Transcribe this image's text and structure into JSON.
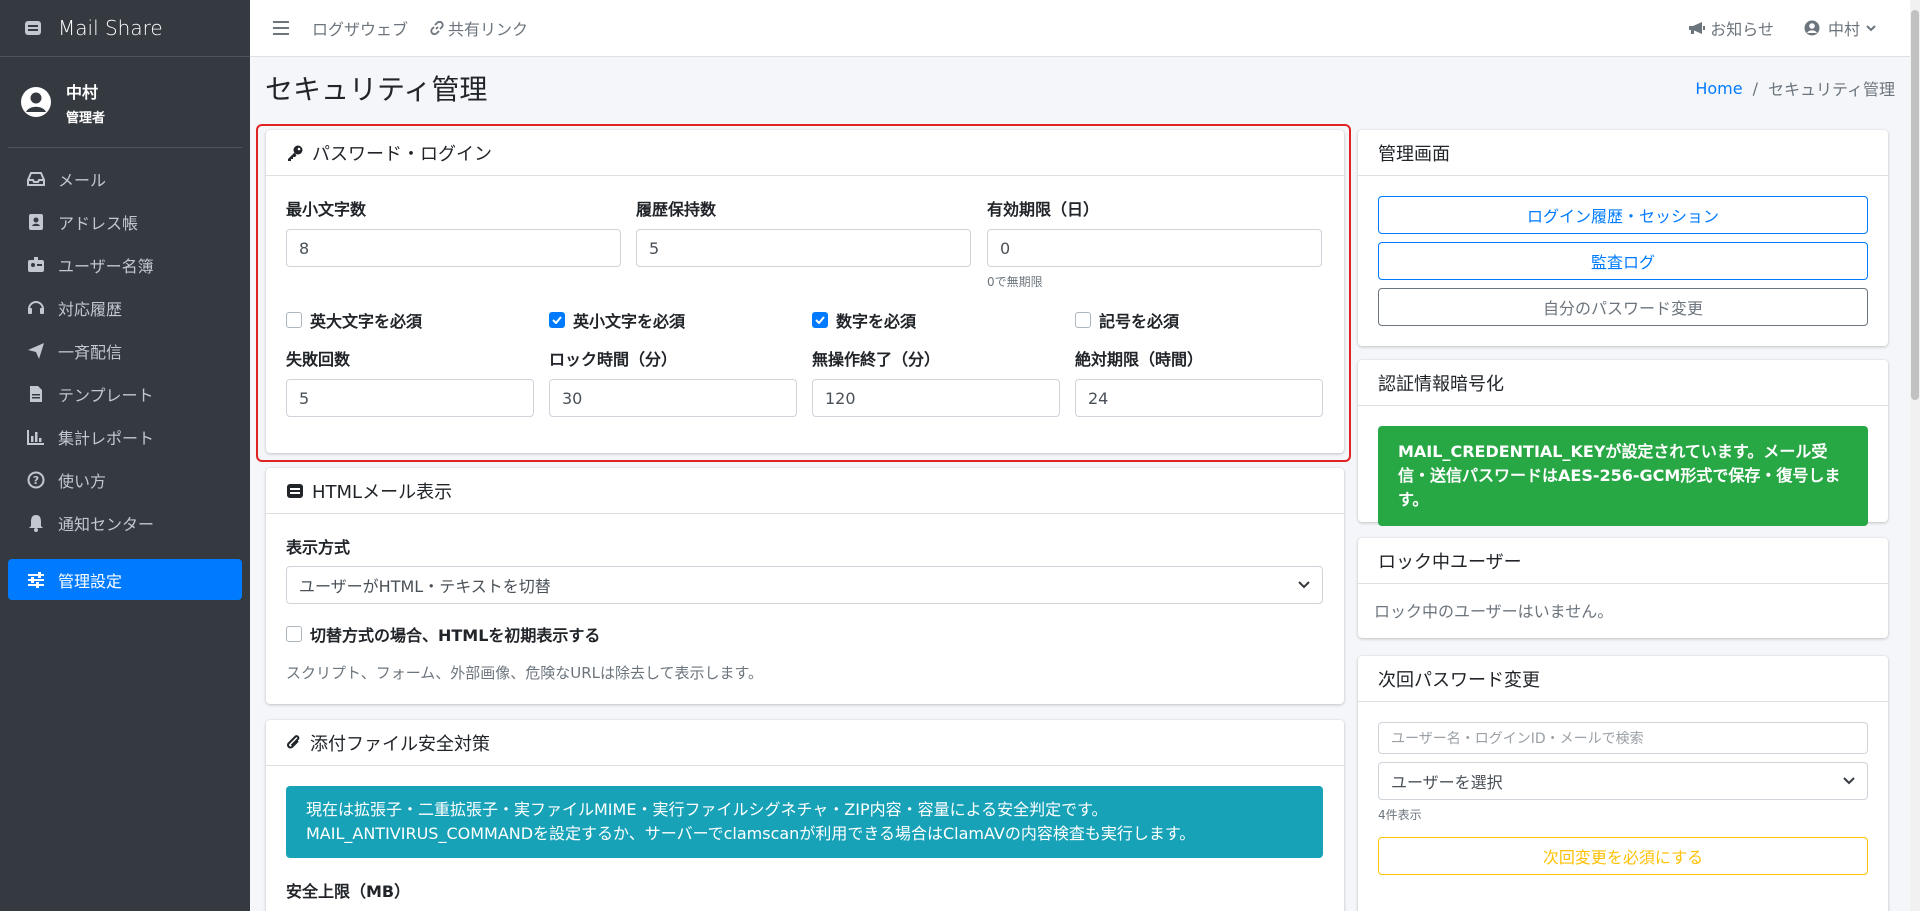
{
  "app": {
    "name": "Mail Share"
  },
  "user": {
    "name": "中村",
    "role": "管理者"
  },
  "sidebar": {
    "items": [
      {
        "label": "メール",
        "icon": "inbox-icon"
      },
      {
        "label": "アドレス帳",
        "icon": "address-book-icon"
      },
      {
        "label": "ユーザー名簿",
        "icon": "id-badge-icon"
      },
      {
        "label": "対応履歴",
        "icon": "headset-icon"
      },
      {
        "label": "一斉配信",
        "icon": "paper-plane-icon"
      },
      {
        "label": "テンプレート",
        "icon": "file-icon"
      },
      {
        "label": "集計レポート",
        "icon": "chart-bar-icon"
      },
      {
        "label": "使い方",
        "icon": "question-icon"
      },
      {
        "label": "通知センター",
        "icon": "bell-icon"
      }
    ],
    "active": {
      "label": "管理設定",
      "icon": "sliders-icon"
    }
  },
  "topbar": {
    "logs": "ログザウェブ",
    "share": "共有リンク",
    "notice": "お知らせ",
    "user": "中村"
  },
  "page": {
    "title": "セキュリティ管理",
    "breadcrumb_home": "Home",
    "breadcrumb_sep": "/",
    "breadcrumb_current": "セキュリティ管理"
  },
  "password": {
    "title": "パスワード・ログイン",
    "min_len_label": "最小文字数",
    "min_len": "8",
    "history_label": "履歴保持数",
    "history": "5",
    "expiry_label": "有効期限（日）",
    "expiry": "0",
    "expiry_help": "0で無期限",
    "upper_label": "英大文字を必須",
    "upper_checked": false,
    "lower_label": "英小文字を必須",
    "lower_checked": true,
    "digit_label": "数字を必須",
    "digit_checked": true,
    "symbol_label": "記号を必須",
    "symbol_checked": false,
    "fail_label": "失敗回数",
    "fail": "5",
    "lock_label": "ロック時間（分）",
    "lock": "30",
    "idle_label": "無操作終了（分）",
    "idle": "120",
    "absolute_label": "絶対期限（時間）",
    "absolute": "24"
  },
  "html_mail": {
    "title": "HTMLメール表示",
    "mode_label": "表示方式",
    "mode_value": "ユーザーがHTML・テキストを切替",
    "initial_label": "切替方式の場合、HTMLを初期表示する",
    "note": "スクリプト、フォーム、外部画像、危険なURLは除去して表示します。"
  },
  "attach": {
    "title": "添付ファイル安全対策",
    "info_line1": "現在は拡張子・二重拡張子・実ファイルMIME・実行ファイルシグネチャ・ZIP内容・容量による安全判定です。",
    "info_line2": "MAIL_ANTIVIRUS_COMMANDを設定するか、サーバーでclamscanが利用できる場合はClamAVの内容検査も実行します。",
    "limit_label": "安全上限（MB）"
  },
  "admin": {
    "title": "管理画面",
    "btn_login_history": "ログイン履歴・セッション",
    "btn_audit": "監査ログ",
    "btn_change_pw": "自分のパスワード変更"
  },
  "credential": {
    "title": "認証情報暗号化",
    "message": "MAIL_CREDENTIAL_KEYが設定されています。メール受信・送信パスワードはAES-256-GCM形式で保存・復号します。"
  },
  "locked": {
    "title": "ロック中ユーザー",
    "message": "ロック中のユーザーはいません。"
  },
  "next_pw": {
    "title": "次回パスワード変更",
    "search_placeholder": "ユーザー名・ログインID・メールで検索",
    "select_value": "ユーザーを選択",
    "count": "4件表示",
    "button": "次回変更を必須にする"
  },
  "colors": {
    "primary": "#007bff",
    "success": "#28a745",
    "info": "#17a2b8",
    "warning": "#ffc107",
    "sidebar": "#343a40",
    "highlight": "#e02424"
  }
}
